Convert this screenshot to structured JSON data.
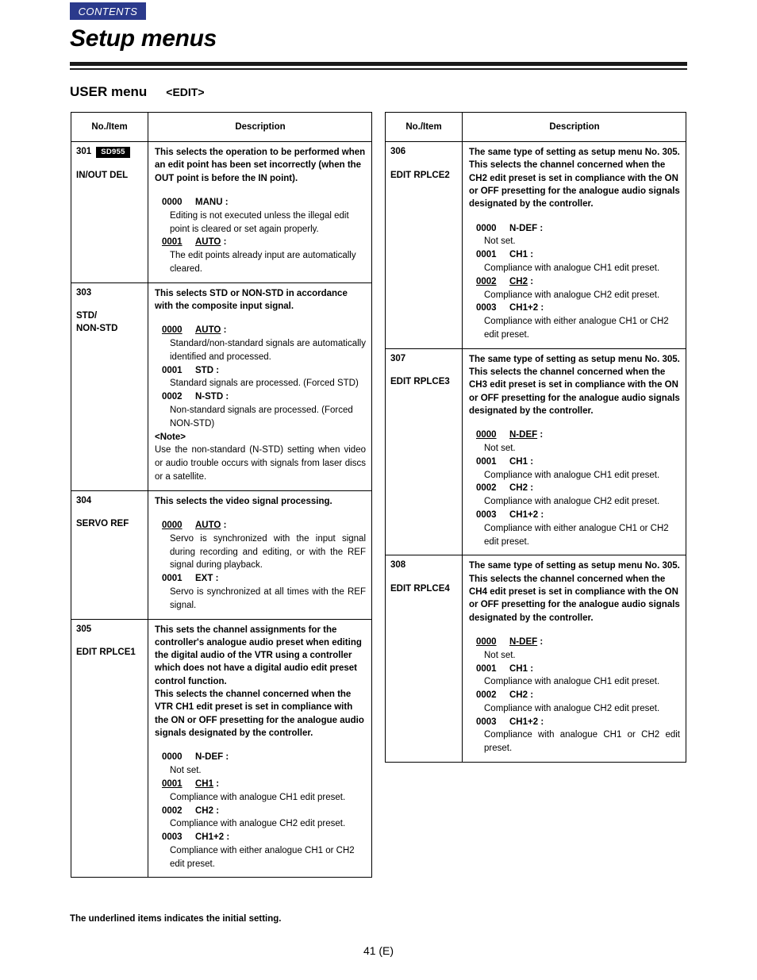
{
  "header": {
    "contents_tab": "CONTENTS",
    "title": "Setup menus",
    "menu_name": "USER menu",
    "menu_sub": "<EDIT>"
  },
  "table_headers": {
    "col_no": "No./Item",
    "col_desc": "Description"
  },
  "left_rows": [
    {
      "no": "301",
      "badge": "SD955",
      "name": "IN/OUT DEL",
      "lead": [
        "This selects the operation to be performed when an edit point has been set incorrectly (when the OUT point is before the IN point)."
      ],
      "options": [
        {
          "code": "0000",
          "label": "MANU",
          "initial": false,
          "body": "Editing is not executed unless the illegal edit point is cleared or set again properly."
        },
        {
          "code": "0001",
          "label": "AUTO",
          "initial": true,
          "body": "The edit points already input are automatically cleared."
        }
      ]
    },
    {
      "no": "303",
      "badge": "",
      "name": "STD/\nNON-STD",
      "lead": [
        "This selects STD or NON-STD in accordance with the composite input signal."
      ],
      "options": [
        {
          "code": "0000",
          "label": "AUTO",
          "initial": true,
          "justify": true,
          "body": "Standard/non-standard signals are automatically identified and processed."
        },
        {
          "code": "0001",
          "label": "STD",
          "initial": false,
          "body": "Standard signals are processed. (Forced STD)"
        },
        {
          "code": "0002",
          "label": "N-STD",
          "initial": false,
          "body": "Non-standard signals are processed. (Forced NON-STD)"
        }
      ],
      "note_head": "<Note>",
      "note_body": "Use the non-standard (N-STD) setting when video or audio trouble occurs with signals from laser discs or a satellite."
    },
    {
      "no": "304",
      "badge": "",
      "name": "SERVO REF",
      "lead": [
        "This selects the video signal processing."
      ],
      "options": [
        {
          "code": "0000",
          "label": "AUTO",
          "initial": true,
          "justify": true,
          "body": "Servo is synchronized with the input signal during recording and editing, or with the REF signal during playback."
        },
        {
          "code": "0001",
          "label": "EXT",
          "initial": false,
          "justify": true,
          "body": "Servo is synchronized at all times with the REF signal."
        }
      ]
    },
    {
      "no": "305",
      "badge": "",
      "name": "EDIT RPLCE1",
      "lead": [
        "This sets the channel assignments for the controller's analogue audio preset when editing the digital audio of the VTR using a controller which does not have a digital audio edit preset control function.",
        "This selects the channel concerned when the VTR CH1 edit preset is set in compliance with the ON or OFF presetting for the analogue audio signals designated by the controller."
      ],
      "options": [
        {
          "code": "0000",
          "label": "N-DEF",
          "initial": false,
          "body": "Not set."
        },
        {
          "code": "0001",
          "label": "CH1",
          "initial": true,
          "body": "Compliance with analogue CH1 edit preset."
        },
        {
          "code": "0002",
          "label": "CH2",
          "initial": false,
          "body": "Compliance with analogue CH2 edit preset."
        },
        {
          "code": "0003",
          "label": "CH1+2",
          "initial": false,
          "body": "Compliance with either analogue CH1 or CH2 edit preset."
        }
      ]
    }
  ],
  "right_rows": [
    {
      "no": "306",
      "badge": "",
      "name": "EDIT RPLCE2",
      "lead": [
        "The same type of setting as setup menu No. 305. This selects the channel concerned when the CH2 edit preset is set in compliance with the ON or OFF presetting for the analogue audio signals designated by the controller."
      ],
      "options": [
        {
          "code": "0000",
          "label": "N-DEF",
          "initial": false,
          "body": "Not set."
        },
        {
          "code": "0001",
          "label": "CH1",
          "initial": false,
          "body": "Compliance with analogue CH1 edit preset."
        },
        {
          "code": "0002",
          "label": "CH2",
          "initial": true,
          "body": "Compliance with analogue CH2 edit preset."
        },
        {
          "code": "0003",
          "label": "CH1+2",
          "initial": false,
          "body": "Compliance with either analogue CH1 or CH2 edit preset."
        }
      ]
    },
    {
      "no": "307",
      "badge": "",
      "name": "EDIT RPLCE3",
      "lead": [
        "The same type of setting as setup menu No. 305. This selects the channel concerned when the CH3 edit preset is set in compliance with the ON or OFF presetting for the analogue audio signals designated by the controller."
      ],
      "options": [
        {
          "code": "0000",
          "label": "N-DEF",
          "initial": true,
          "body": "Not set."
        },
        {
          "code": "0001",
          "label": "CH1",
          "initial": false,
          "body": "Compliance with analogue CH1 edit preset."
        },
        {
          "code": "0002",
          "label": "CH2",
          "initial": false,
          "body": "Compliance with analogue CH2 edit preset."
        },
        {
          "code": "0003",
          "label": "CH1+2",
          "initial": false,
          "body": "Compliance with either analogue CH1 or CH2 edit preset."
        }
      ]
    },
    {
      "no": "308",
      "badge": "",
      "name": "EDIT RPLCE4",
      "lead": [
        "The same type of setting as setup menu No. 305. This selects the channel concerned when the CH4 edit preset is set in compliance with the ON or OFF presetting for the analogue audio signals designated by the controller."
      ],
      "options": [
        {
          "code": "0000",
          "label": "N-DEF",
          "initial": true,
          "body": "Not set."
        },
        {
          "code": "0001",
          "label": "CH1",
          "initial": false,
          "body": "Compliance with analogue CH1 edit preset."
        },
        {
          "code": "0002",
          "label": "CH2",
          "initial": false,
          "body": "Compliance with analogue CH2 edit preset."
        },
        {
          "code": "0003",
          "label": "CH1+2",
          "initial": false,
          "justify": true,
          "body": "Compliance with analogue CH1 or CH2 edit preset."
        }
      ]
    }
  ],
  "footer": {
    "footnote": "The underlined items indicates the initial setting.",
    "page_number": "41 (E)"
  },
  "colors": {
    "contents_tab_bg": "#2b3a8c",
    "rule": "#1a1a1a",
    "badge_bg": "#000000"
  }
}
